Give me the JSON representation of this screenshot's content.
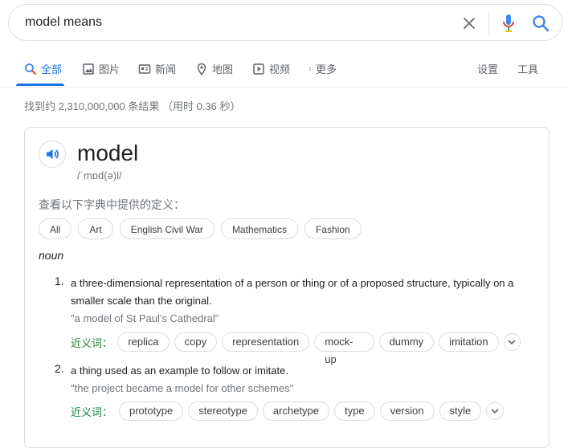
{
  "search": {
    "query": "model means"
  },
  "tabs": [
    {
      "label": "全部",
      "icon": "search-icon"
    },
    {
      "label": "图片",
      "icon": "image-icon"
    },
    {
      "label": "新闻",
      "icon": "news-icon"
    },
    {
      "label": "地图",
      "icon": "map-pin-icon"
    },
    {
      "label": "视频",
      "icon": "play-icon"
    },
    {
      "label": "更多",
      "icon": "more-vert-icon"
    }
  ],
  "tools": {
    "settings": "设置",
    "tools": "工具"
  },
  "stats": "找到约 2,310,000,000 条结果 （用时 0.36 秒）",
  "card": {
    "headword": "model",
    "phonetic": "/ˈmɒd(ə)l/",
    "dict_note": "查看以下字典中提供的定义：",
    "chips": [
      "All",
      "Art",
      "English Civil War",
      "Mathematics",
      "Fashion"
    ],
    "pos": "noun",
    "senses": [
      {
        "num": "1.",
        "definition": "a three-dimensional representation of a person or thing or of a proposed structure, typically on a smaller scale than the original.",
        "example": "\"a model of St Paul's Cathedral\"",
        "syn_label": "近义词：",
        "synonyms": [
          "replica",
          "copy",
          "representation",
          "mock-up",
          "dummy",
          "imitation"
        ]
      },
      {
        "num": "2.",
        "definition": "a thing used as an example to follow or imitate.",
        "example": "\"the project became a model for other schemes\"",
        "syn_label": "近义词：",
        "synonyms": [
          "prototype",
          "stereotype",
          "archetype",
          "type",
          "version",
          "style"
        ]
      }
    ]
  },
  "colors": {
    "accent": "#1a73e8",
    "green": "#188038",
    "muted": "#70757a"
  }
}
